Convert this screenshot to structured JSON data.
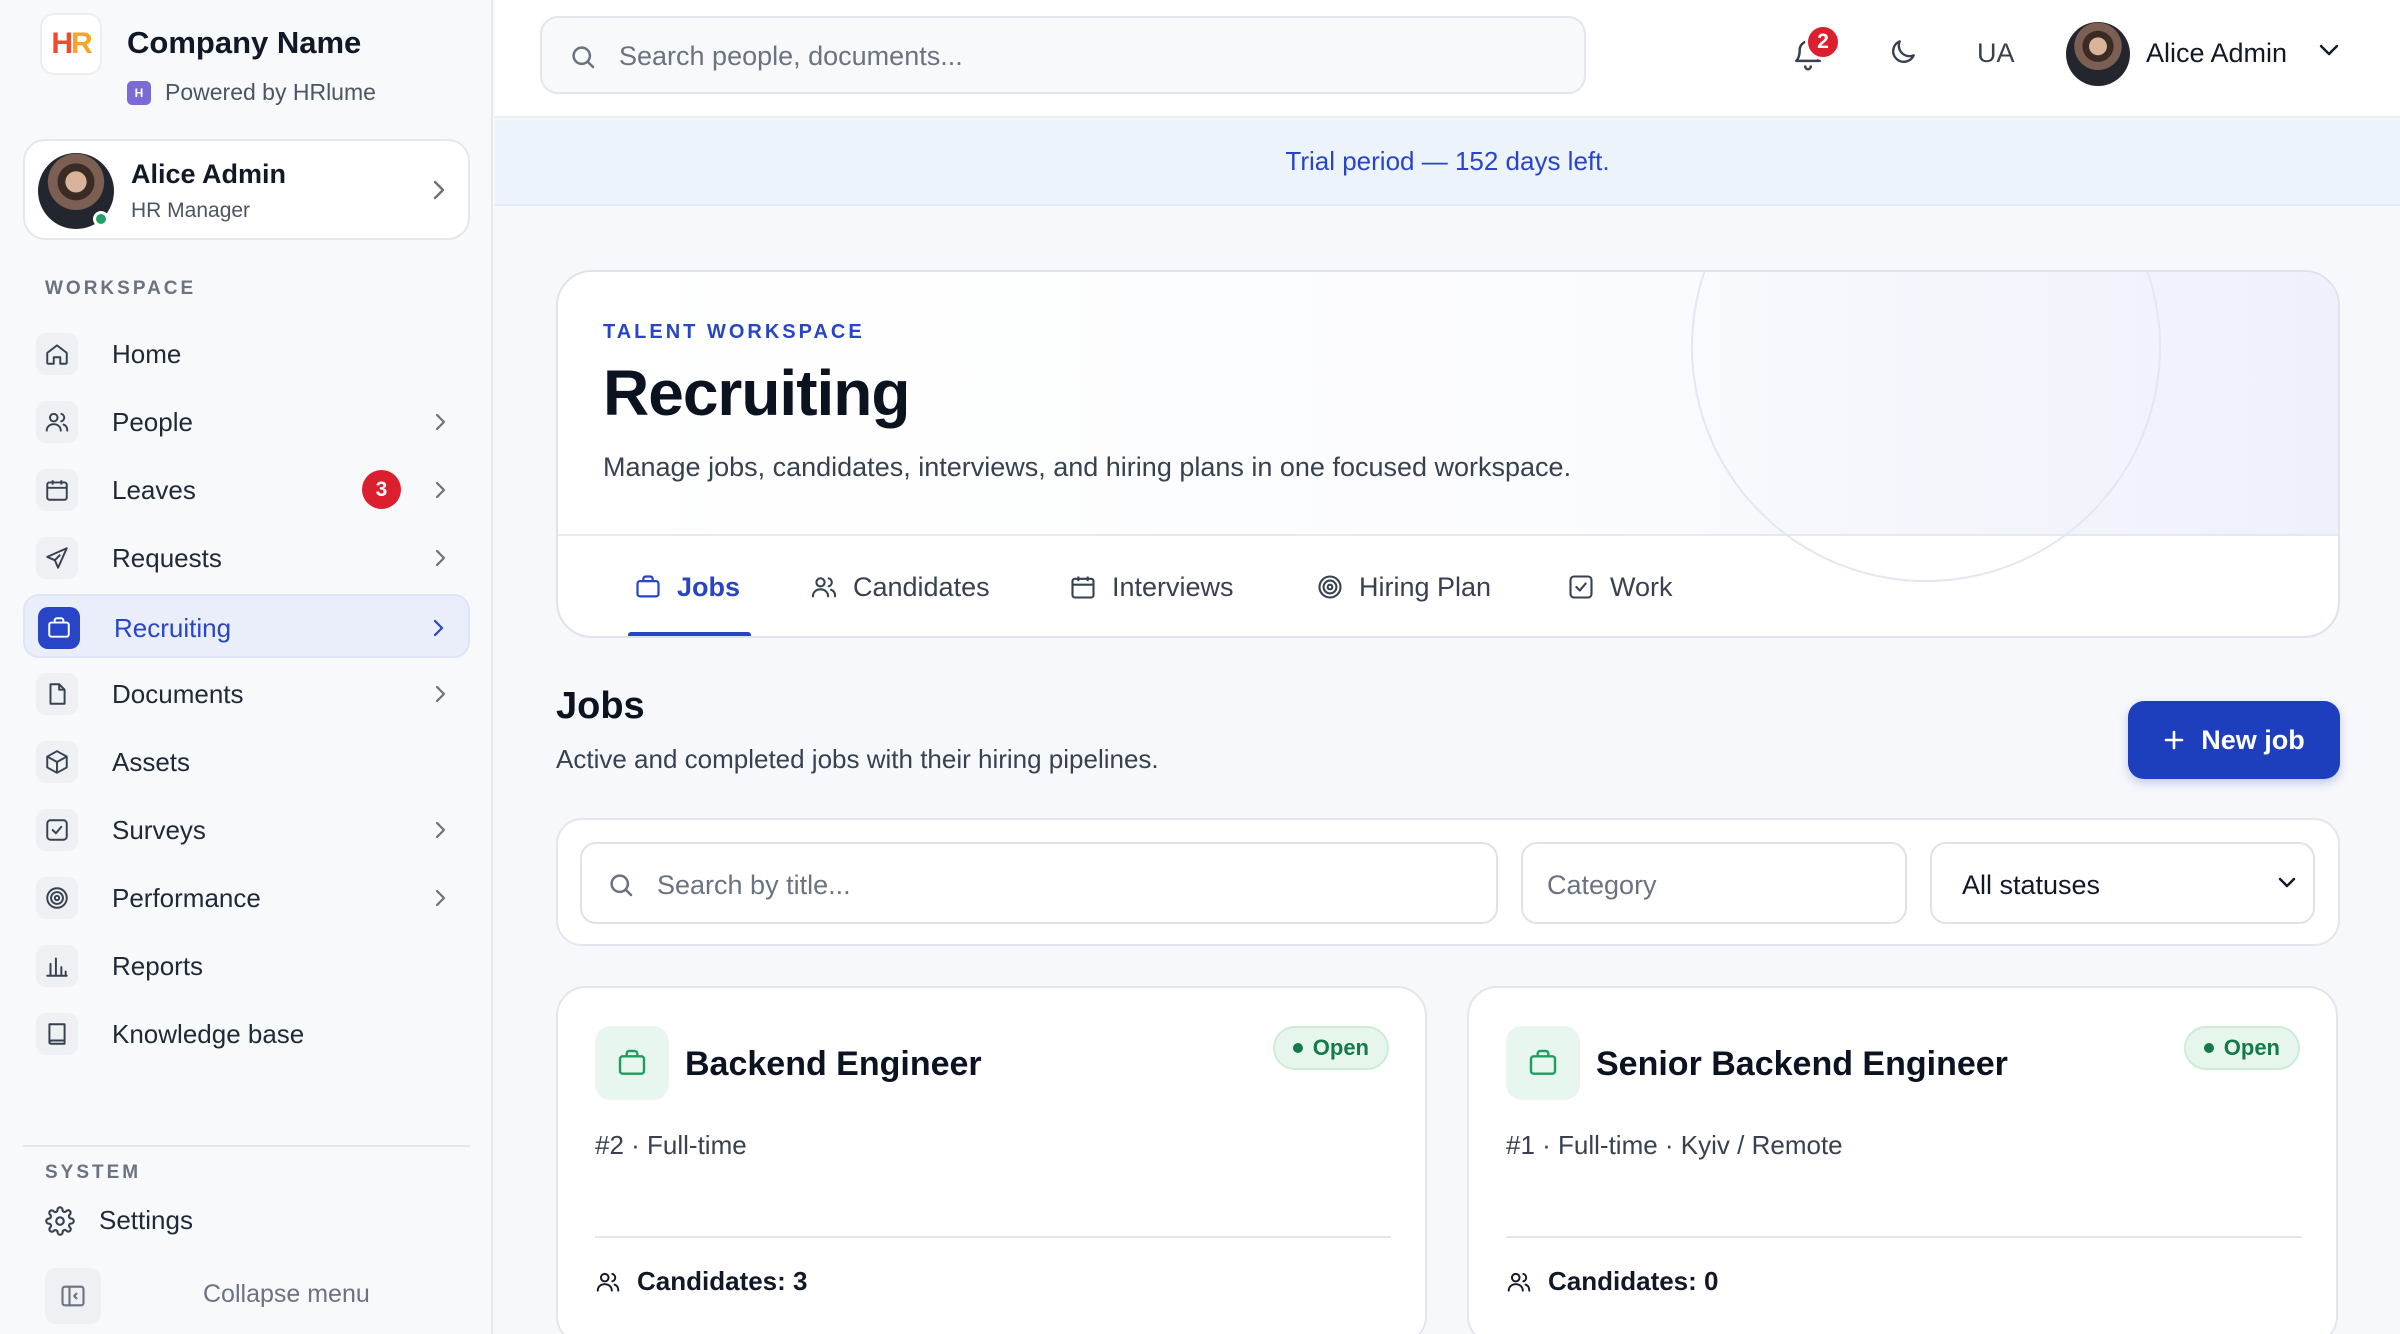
{
  "brand": {
    "logo_text": "HR",
    "company_name": "Company Name",
    "powered_by": "Powered by HRlume"
  },
  "user": {
    "name": "Alice Admin",
    "role": "HR Manager"
  },
  "sidebar": {
    "workspace_label": "WORKSPACE",
    "items": [
      {
        "label": "Home",
        "icon": "home-icon",
        "chevron": false
      },
      {
        "label": "People",
        "icon": "users-icon",
        "chevron": true
      },
      {
        "label": "Leaves",
        "icon": "calendar-icon",
        "chevron": true,
        "badge": "3"
      },
      {
        "label": "Requests",
        "icon": "send-icon",
        "chevron": true
      },
      {
        "label": "Recruiting",
        "icon": "briefcase-icon",
        "chevron": true,
        "active": true
      },
      {
        "label": "Documents",
        "icon": "file-icon",
        "chevron": true
      },
      {
        "label": "Assets",
        "icon": "box-icon",
        "chevron": false
      },
      {
        "label": "Surveys",
        "icon": "checkbox-icon",
        "chevron": true
      },
      {
        "label": "Performance",
        "icon": "target-icon",
        "chevron": true
      },
      {
        "label": "Reports",
        "icon": "bar-chart-icon",
        "chevron": false
      },
      {
        "label": "Knowledge base",
        "icon": "book-icon",
        "chevron": false
      }
    ],
    "system_label": "SYSTEM",
    "settings_label": "Settings",
    "collapse_label": "Collapse menu"
  },
  "topbar": {
    "search_placeholder": "Search people, documents...",
    "notification_count": "2",
    "language": "UA",
    "user_name": "Alice Admin"
  },
  "trial_banner": "Trial period — 152 days left.",
  "hero": {
    "eyebrow": "TALENT WORKSPACE",
    "title": "Recruiting",
    "subtitle": "Manage jobs, candidates, interviews, and hiring plans in one focused workspace.",
    "tabs": [
      {
        "label": "Jobs",
        "icon": "briefcase-icon",
        "active": true
      },
      {
        "label": "Candidates",
        "icon": "users-icon"
      },
      {
        "label": "Interviews",
        "icon": "calendar-icon"
      },
      {
        "label": "Hiring Plan",
        "icon": "target-icon"
      },
      {
        "label": "Work",
        "icon": "checkbox-icon"
      }
    ]
  },
  "jobs": {
    "title": "Jobs",
    "subtitle": "Active and completed jobs with their hiring pipelines.",
    "new_job_label": "New job",
    "filters": {
      "search_placeholder": "Search by title...",
      "category_placeholder": "Category",
      "status_value": "All statuses"
    },
    "cards": [
      {
        "title": "Backend Engineer",
        "status": "Open",
        "meta": "#2 · Full-time",
        "candidates": "Candidates: 3"
      },
      {
        "title": "Senior Backend Engineer",
        "status": "Open",
        "meta": "#1 · Full-time · Kyiv / Remote",
        "candidates": "Candidates: 0"
      }
    ]
  },
  "colors": {
    "accent": "#2845c7",
    "button": "#1e3fbd",
    "danger": "#dc1f2e",
    "success": "#16794a"
  }
}
